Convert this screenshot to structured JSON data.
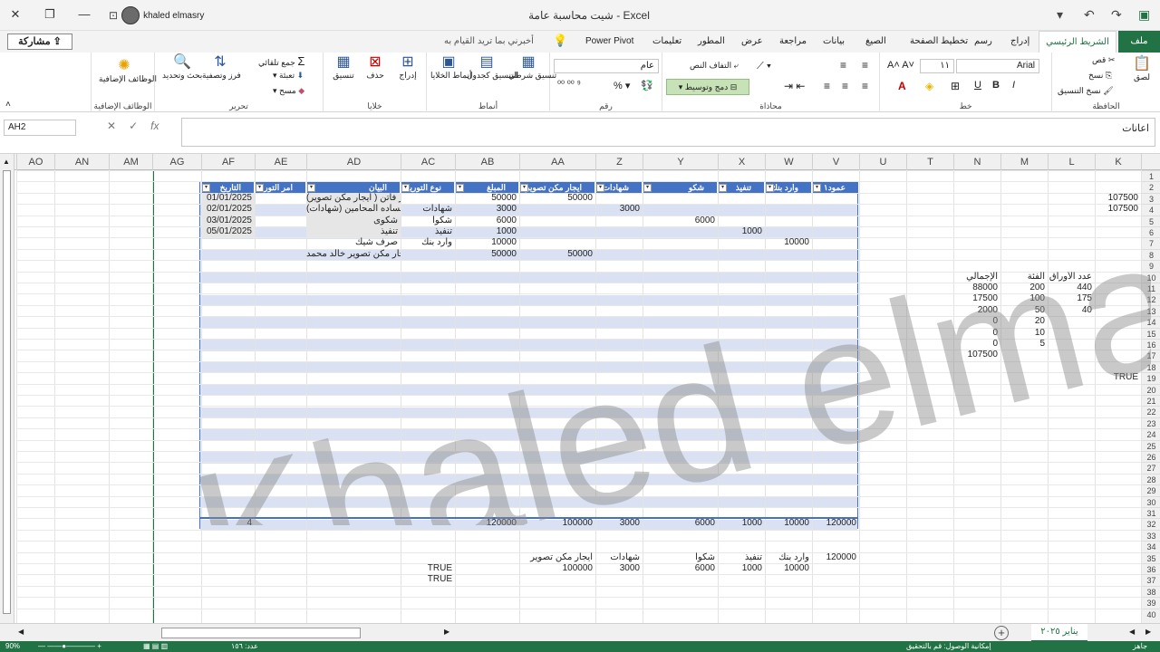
{
  "window": {
    "title": "شيت محاسبة عامة  -  Excel",
    "user": "khaled elmasry",
    "share": "مشاركة",
    "tell_me": "أخبرني بما تريد القيام به"
  },
  "tabs": [
    "ملف",
    "الشريط الرئيسي",
    "إدراج",
    "رسم",
    "تخطيط الصفحة",
    "الصيغ",
    "بيانات",
    "مراجعة",
    "عرض",
    "المطور",
    "تعليمات",
    "Power Pivot"
  ],
  "ribbon": {
    "clipboard": {
      "label": "الحافظة",
      "paste": "لصق",
      "cut": "قص",
      "copy": "نسخ",
      "format_painter": "نسخ التنسيق"
    },
    "font": {
      "label": "خط",
      "name": "Arial",
      "size": "١١"
    },
    "alignment": {
      "label": "محاذاة",
      "wrap": "التفاف النص",
      "merge": "دمج وتوسيط"
    },
    "number": {
      "label": "رقم",
      "format": "عام"
    },
    "styles": {
      "label": "أنماط",
      "conditional": "تنسيق شرطي",
      "as_table": "التنسيق كجدول",
      "cell_styles": "أنماط الخلايا"
    },
    "cells": {
      "label": "خلايا",
      "insert": "إدراج",
      "delete": "حذف",
      "format": "تنسيق"
    },
    "editing": {
      "label": "تحرير",
      "autosum": "جمع تلقائي",
      "fill": "تعبئة",
      "clear": "مسح",
      "sort": "فرز وتصفية",
      "find": "بحث وتحديد"
    },
    "addins": {
      "label": "الوظائف الإضافية",
      "btn": "الوظائف الإضافية"
    }
  },
  "formula": {
    "namebox": "AH2",
    "content": "اعانات"
  },
  "columns": [
    "AO",
    "AN",
    "AM",
    "AG",
    "AF",
    "AE",
    "AD",
    "AC",
    "AB",
    "AA",
    "Z",
    "Y",
    "X",
    "W",
    "V",
    "U",
    "T",
    "N",
    "M",
    "L",
    "K"
  ],
  "rows": [
    "1",
    "2",
    "3",
    "4",
    "5",
    "6",
    "7",
    "8",
    "9",
    "10",
    "11",
    "12",
    "13",
    "14",
    "15",
    "16",
    "17",
    "18",
    "19",
    "20",
    "21",
    "22",
    "23",
    "24",
    "25",
    "26",
    "27",
    "28",
    "29",
    "30",
    "31",
    "32",
    "33",
    "34",
    "35",
    "36",
    "37",
    "38",
    "39",
    "40"
  ],
  "table": {
    "headers": [
      "التاريخ",
      "امر التوريد",
      "البيان",
      "نوع التوريد",
      "المبلغ",
      "ايجار مكن تصوير",
      "شهادات",
      "شكو",
      "تنفيذ",
      "وارد بنك",
      "عمود١"
    ],
    "rows": [
      [
        "01/01/2025",
        "",
        "ايجار مكن تصوير فاتن ( ايجار مكن تصوير)",
        "",
        "50000",
        "50000",
        "",
        "",
        "",
        "",
        ""
      ],
      [
        "02/01/2025",
        "",
        "الساده المحامين (شهادات)",
        "شهادات",
        "3000",
        "",
        "3000",
        "",
        "",
        "",
        ""
      ],
      [
        "03/01/2025",
        "",
        "شكوى",
        "شكوا",
        "6000",
        "",
        "",
        "6000",
        "",
        "",
        ""
      ],
      [
        "05/01/2025",
        "",
        "تنفيذ",
        "تنفيذ",
        "1000",
        "",
        "",
        "",
        "1000",
        "",
        ""
      ],
      [
        "",
        "",
        "صرف شيك",
        "وارد بنك",
        "10000",
        "",
        "",
        "",
        "",
        "10000",
        ""
      ],
      [
        "",
        "",
        "ايجار مكن تصوير خالد محمد",
        "",
        "50000",
        "50000",
        "",
        "",
        "",
        "",
        ""
      ]
    ],
    "totals": {
      "count": "4",
      "amount": "120000",
      "rent": "100000",
      "cert": "3000",
      "complaint": "6000",
      "exec": "1000",
      "bank": "10000",
      "total": "120000"
    }
  },
  "right_block": {
    "k3": "107500",
    "k4": "107500",
    "headers": {
      "count": "عدد الأوراق",
      "cat": "الفئة",
      "total": "الإجمالي"
    },
    "rows": [
      [
        "440",
        "200",
        "88000"
      ],
      [
        "175",
        "100",
        "17500"
      ],
      [
        "40",
        "50",
        "2000"
      ],
      [
        "",
        "20",
        "0"
      ],
      [
        "",
        "10",
        "0"
      ],
      [
        "",
        "5",
        "0"
      ]
    ],
    "sum": "107500",
    "k19": "TRUE"
  },
  "summary": {
    "labels": [
      "وارد بنك",
      "تنفيذ",
      "شكوا",
      "شهادات",
      "ايجار مكن تصوير"
    ],
    "values": [
      "10000",
      "1000",
      "6000",
      "3000",
      "100000"
    ],
    "v35": "120000",
    "true1": "TRUE",
    "true2": "TRUE"
  },
  "sheet_tab": "يناير ٢٠٢٥",
  "status": {
    "ready": "جاهز",
    "accessibility": "إمكانية الوصول: قم بالتحقيق",
    "zoom": "90%",
    "count": "عدد: ١٥٦"
  },
  "watermark": "Khaled elmasry"
}
